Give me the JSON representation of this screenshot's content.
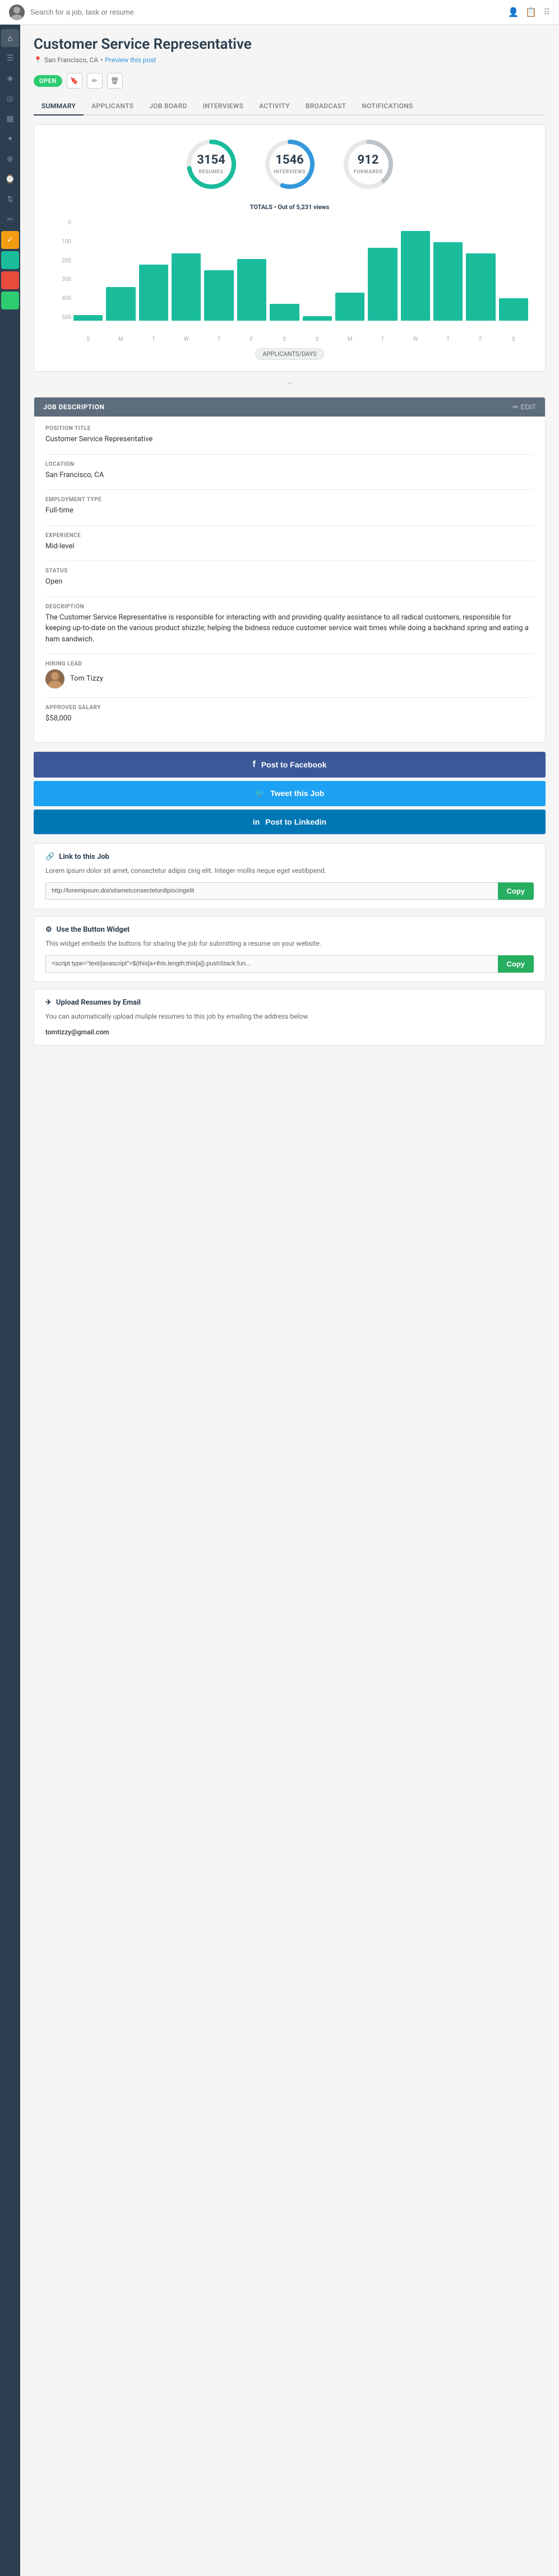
{
  "topnav": {
    "search_placeholder": "Search for a job, task or resume"
  },
  "sidebar": {
    "items": [
      {
        "icon": "⌂",
        "label": "home",
        "active": false
      },
      {
        "icon": "☰",
        "label": "menu",
        "active": false
      },
      {
        "icon": "♦",
        "label": "diamond",
        "active": false
      },
      {
        "icon": "◎",
        "label": "circle",
        "active": false
      },
      {
        "icon": "▦",
        "label": "grid",
        "active": false
      },
      {
        "icon": "✦",
        "label": "star",
        "active": false
      },
      {
        "icon": "⊕",
        "label": "plus-circle",
        "active": false
      },
      {
        "icon": "⌚",
        "label": "clock",
        "active": false
      },
      {
        "icon": "⇅",
        "label": "arrows",
        "active": false
      },
      {
        "icon": "✂",
        "label": "scissors",
        "active": false
      },
      {
        "icon": "☑",
        "label": "check",
        "active": true,
        "highlight": "highlight-yellow"
      },
      {
        "icon": "■",
        "label": "square-blue",
        "active": false,
        "highlight": "highlight-teal"
      },
      {
        "icon": "■",
        "label": "square-red",
        "active": false,
        "highlight": "highlight-red"
      },
      {
        "icon": "■",
        "label": "square-green",
        "active": false,
        "highlight": "highlight-green"
      }
    ]
  },
  "page": {
    "title": "Customer Service Representative",
    "location": "San Francisco, CA",
    "preview_link": "Preview this post",
    "status_badge": "OPEN"
  },
  "tabs": [
    {
      "label": "Summary",
      "active": true
    },
    {
      "label": "Applicants",
      "active": false
    },
    {
      "label": "Job Board",
      "active": false
    },
    {
      "label": "Interviews",
      "active": false
    },
    {
      "label": "Activity",
      "active": false
    },
    {
      "label": "Broadcast",
      "active": false
    },
    {
      "label": "Notifications",
      "active": false
    }
  ],
  "stats": {
    "resumes": {
      "value": "3154",
      "label": "Resumes",
      "percent": 85
    },
    "interviews": {
      "value": "1546",
      "label": "Interviews",
      "percent": 65
    },
    "forwards": {
      "value": "912",
      "label": "Forwards",
      "percent": 45
    }
  },
  "totals": {
    "label": "TOTALS",
    "separator": "•",
    "text": "Out of",
    "views": "5,231",
    "views_label": "views"
  },
  "chart": {
    "y_labels": [
      "500",
      "400",
      "300",
      "200",
      "100",
      "0"
    ],
    "bars": [
      {
        "label": "S",
        "height": 10
      },
      {
        "label": "M",
        "height": 60
      },
      {
        "label": "T",
        "height": 100
      },
      {
        "label": "W",
        "height": 120
      },
      {
        "label": "T",
        "height": 90
      },
      {
        "label": "F",
        "height": 110
      },
      {
        "label": "S",
        "height": 30
      },
      {
        "label": "S",
        "height": 8
      },
      {
        "label": "M",
        "height": 50
      },
      {
        "label": "T",
        "height": 130
      },
      {
        "label": "W",
        "height": 160
      },
      {
        "label": "T",
        "height": 140
      },
      {
        "label": "F",
        "height": 120
      },
      {
        "label": "S",
        "height": 40
      }
    ],
    "footer_label": "APPLICANTS/DAYS"
  },
  "job_description": {
    "header": "JOB DESCRIPTION",
    "edit_label": "EDIT",
    "fields": [
      {
        "label": "Position Title",
        "value": "Customer Service Representative"
      },
      {
        "label": "Location",
        "value": "San Francisco, CA"
      },
      {
        "label": "Employment Type",
        "value": "Full-time"
      },
      {
        "label": "Experience",
        "value": "Mid-level"
      },
      {
        "label": "Status",
        "value": "Open"
      },
      {
        "label": "Description",
        "value": "The Customer Service Representative is responsible for interacting with and providing quality assistance to all radical customers, responsible for keeping up-to-date on the various product shizzle; helping the bidness reduce customer service wait times while doing a backhand spring and eating a ham sandwich."
      },
      {
        "label": "Hiring Lead",
        "value": "Tom Tizzy"
      },
      {
        "label": "Approved Salary",
        "value": "$58,000"
      }
    ]
  },
  "share": {
    "facebook_label": "Post to Facebook",
    "twitter_label": "Tweet this Job",
    "linkedin_label": "Post to Linkedin"
  },
  "link_section": {
    "title": "Link to this Job",
    "description": "Lorem ipsum dolor sit amet, consectetur adipis cing elit. Integer mollis neque eget vestibpend.",
    "url": "http://loremipsum.doi/sitametconsecteturdipiscingelit",
    "copy_label": "Copy"
  },
  "widget_section": {
    "title": "Use the Button Widget",
    "description": "This widget embeds the buttons for sharing the job for submitting a resume on your website.",
    "code": "<script type=\"text/javascript\">$(this[a+this.length;this[a]).pushStack:fun...",
    "copy_label": "Copy"
  },
  "email_section": {
    "title": "Upload Resumes by Email",
    "description": "You can automatically upload muliple resumes to this job by emailing the address below.",
    "email": "tomtizzy@gmail.com"
  }
}
